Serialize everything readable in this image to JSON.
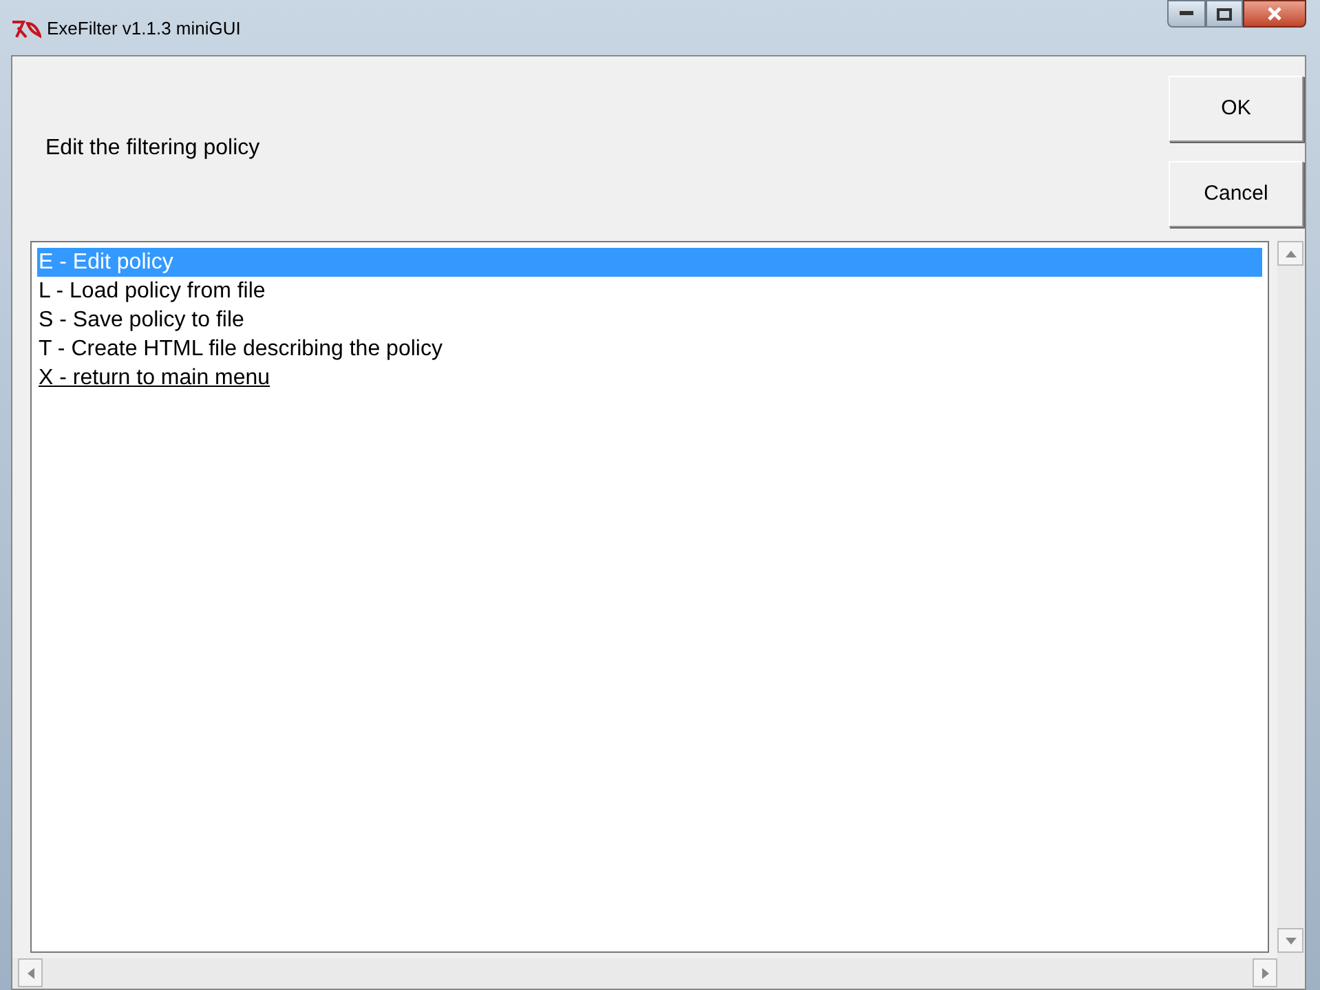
{
  "window": {
    "title": "ExeFilter v1.1.3 miniGUI"
  },
  "prompt": "Edit the filtering policy",
  "buttons": [
    {
      "label": "OK"
    },
    {
      "label": "Cancel"
    }
  ],
  "list": [
    {
      "label": "E - Edit policy",
      "selected": true,
      "active": false
    },
    {
      "label": "L - Load policy from file",
      "selected": false,
      "active": false
    },
    {
      "label": "S - Save policy to file",
      "selected": false,
      "active": false
    },
    {
      "label": "T - Create HTML file describing the policy",
      "selected": false,
      "active": false
    },
    {
      "label": "X - return to main menu",
      "selected": false,
      "active": true
    }
  ]
}
